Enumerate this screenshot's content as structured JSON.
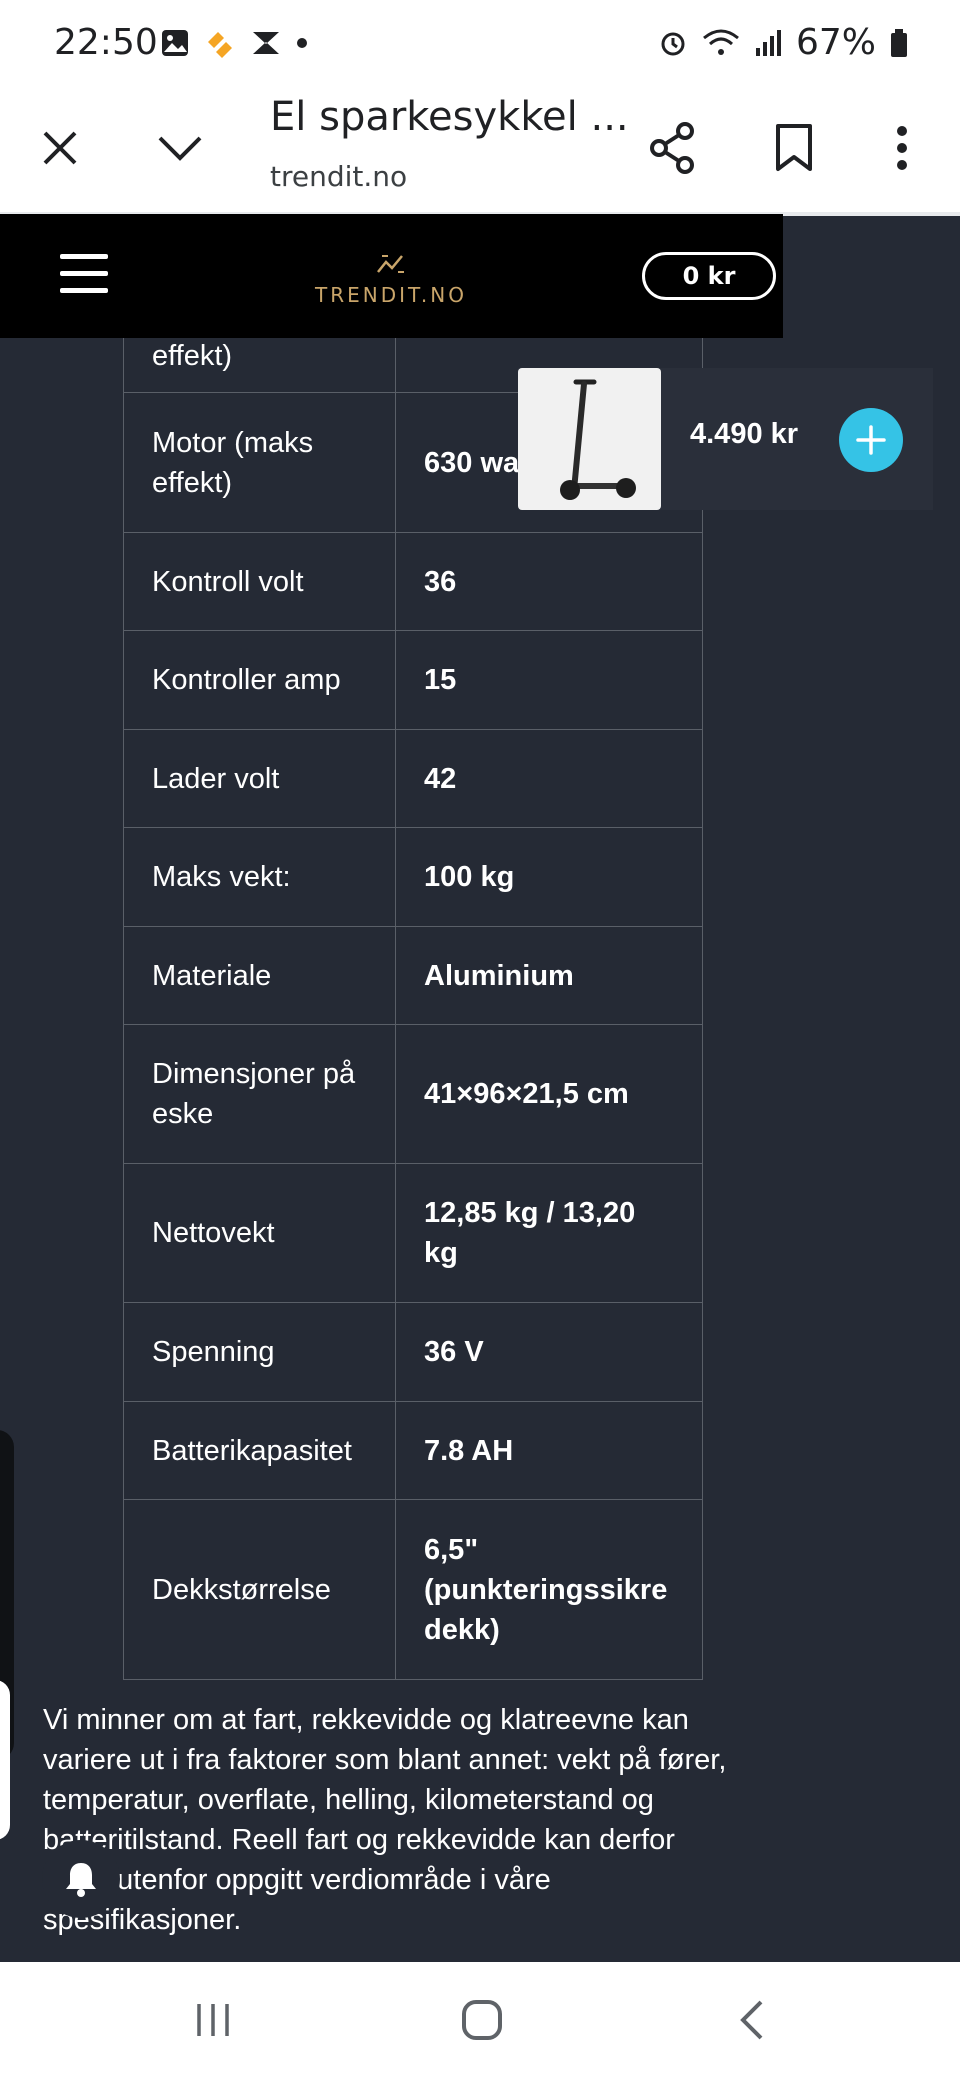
{
  "status_bar": {
    "time": "22:50",
    "battery": "67%"
  },
  "browser": {
    "title": "El sparkesykkel ...",
    "url": "trendit.no"
  },
  "site_header": {
    "logo_text": "TRENDIT.NO",
    "cart_label": "0 kr"
  },
  "sticky_cart": {
    "price": "4.490 kr"
  },
  "specs": {
    "partial_row": {
      "key": "effekt)",
      "value": ""
    },
    "rows": [
      {
        "key": "Motor (maks effekt)",
        "value": "630 watt"
      },
      {
        "key": "Kontroll volt",
        "value": "36"
      },
      {
        "key": "Kontroller amp",
        "value": "15"
      },
      {
        "key": "Lader volt",
        "value": "42"
      },
      {
        "key": "Maks vekt:",
        "value": "100 kg"
      },
      {
        "key": "Materiale",
        "value": "Aluminium"
      },
      {
        "key": "Dimensjoner på eske",
        "value": "41×96×21,5 cm"
      },
      {
        "key": "Nettovekt",
        "value": "12,85 kg / 13,20 kg"
      },
      {
        "key": "Spenning",
        "value": "36 V"
      },
      {
        "key": "Batterikapasitet",
        "value": "7.8 AH"
      },
      {
        "key": "Dekkstørrelse",
        "value": "6,5\" (punkteringssikre dekk)"
      }
    ]
  },
  "disclaimer": "Vi minner om at fart, rekkevidde og klatreevne kan variere ut i fra faktorer som blant annet: vekt på fører, temperatur, overflate, helling, kilometerstand og batteritilstand. Reell fart og rekkevidde kan derfor være utenfor oppgitt verdiområde i våre spesifikasjoner.",
  "icons": {
    "close": "close-icon",
    "collapse": "chevron-down-icon",
    "share": "share-icon",
    "bookmark": "bookmark-icon",
    "menu": "more-vert-icon",
    "hamburger": "hamburger-icon",
    "plus": "plus-icon",
    "bell": "bell-icon"
  },
  "colors": {
    "page_bg": "#252a35",
    "header_bg": "#000000",
    "accent": "#35c3e6",
    "logo_gold": "#c9a56a"
  }
}
